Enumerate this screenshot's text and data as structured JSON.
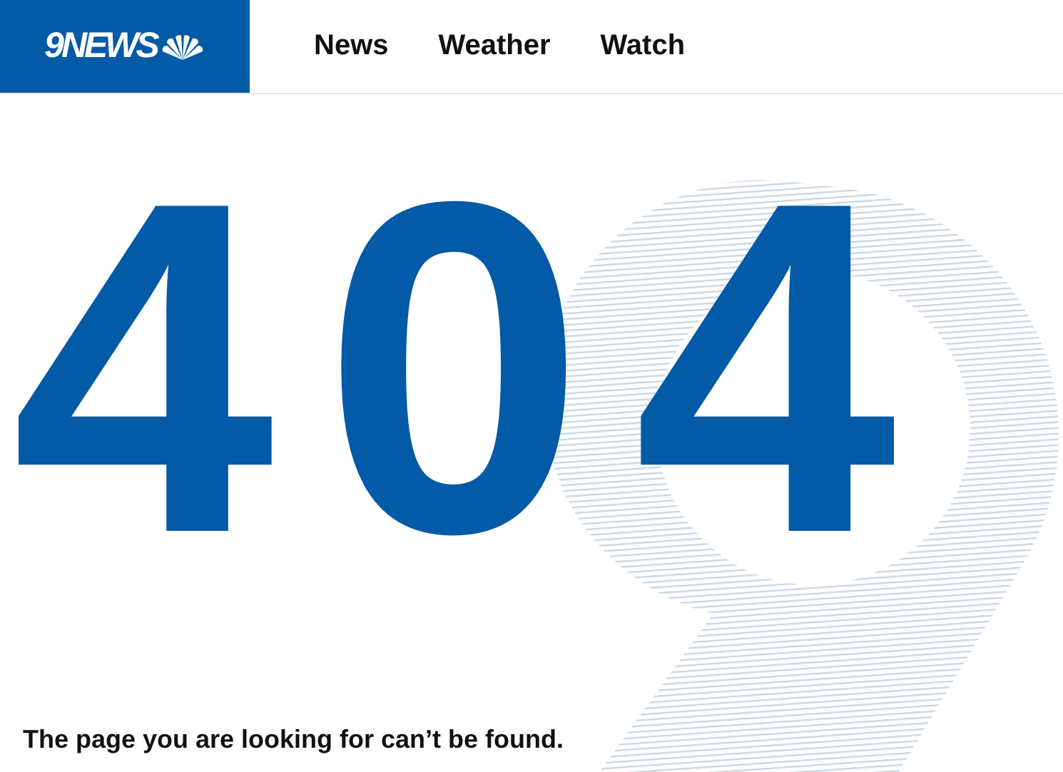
{
  "header": {
    "logo": "9NEWS",
    "nav": [
      {
        "label": "News"
      },
      {
        "label": "Weather"
      },
      {
        "label": "Watch"
      }
    ]
  },
  "error": {
    "code": "404",
    "message": "The page you are looking for can’t be found."
  }
}
